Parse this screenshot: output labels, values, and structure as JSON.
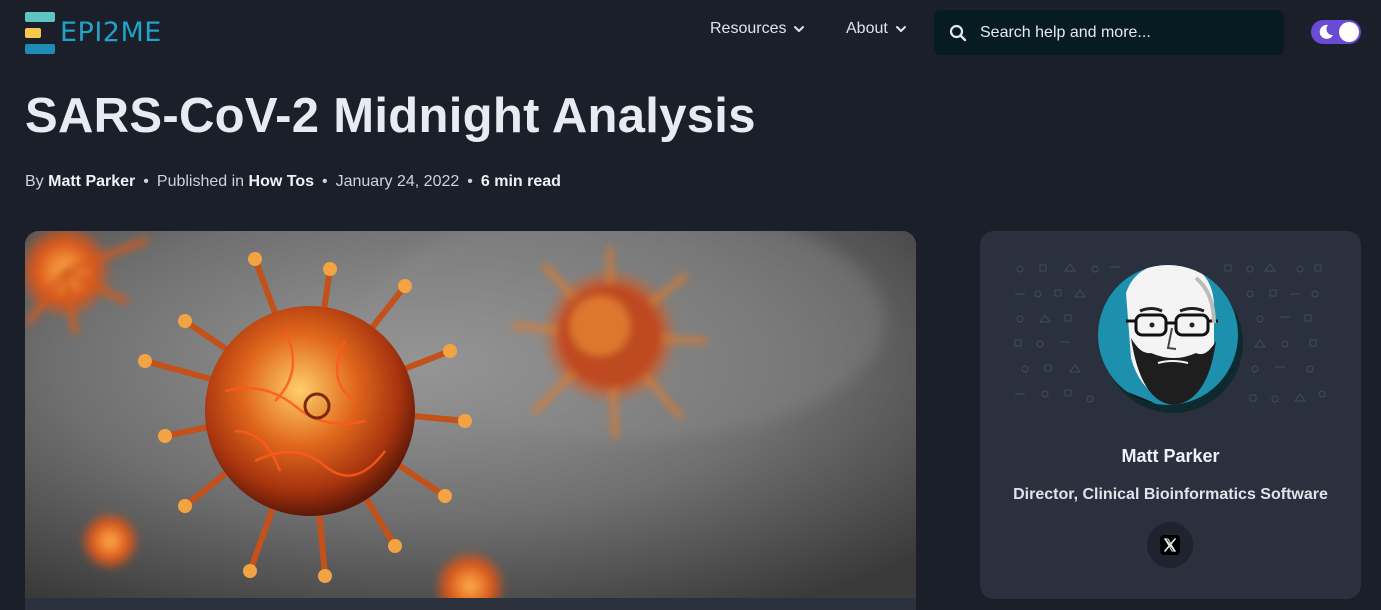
{
  "header": {
    "logo_text": "EPI2ME",
    "nav": [
      {
        "label": "Resources"
      },
      {
        "label": "About"
      }
    ],
    "search": {
      "placeholder": "Search help and more..."
    },
    "theme_toggle": {
      "state": "dark"
    }
  },
  "article": {
    "title": "SARS-CoV-2 Midnight Analysis",
    "meta": {
      "by_prefix": "By",
      "author": "Matt Parker",
      "published_prefix": "Published in",
      "category": "How Tos",
      "date": "January 24, 2022",
      "read_time": "6 min read",
      "separator": "•"
    },
    "hero_image": {
      "icon": "coronavirus-illustration"
    }
  },
  "author_card": {
    "name": "Matt Parker",
    "role": "Director, Clinical Bioinformatics Software",
    "social": [
      {
        "icon": "x-twitter-icon"
      }
    ]
  },
  "colors": {
    "background": "#1b1f2a",
    "card": "#2a303d",
    "accent": "#6a4bd6",
    "logo_teal": "#1fa3c9",
    "search_bg": "#061c22"
  }
}
